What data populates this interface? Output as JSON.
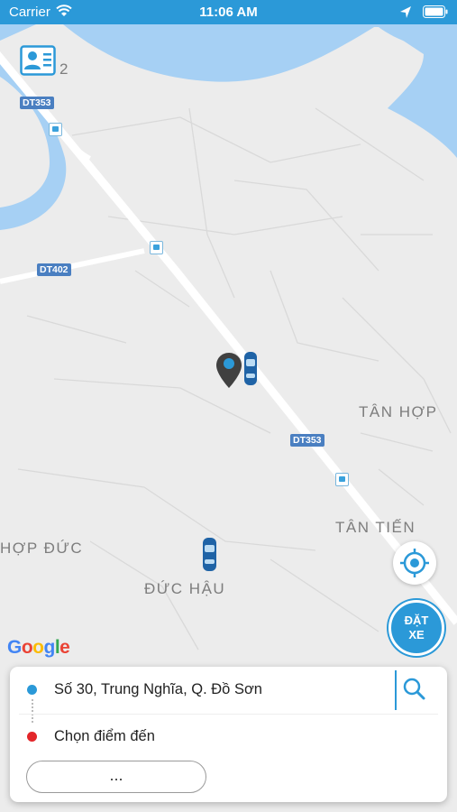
{
  "status_bar": {
    "carrier": "Carrier",
    "time": "11:06 AM"
  },
  "map": {
    "place_labels": {
      "tan_hop": "TÂN HỢP",
      "tan_tien": "TÂN TIẾN",
      "hop_duc": "HỢP ĐỨC",
      "duc_hau": "ĐỨC HẬU",
      "top_left": "2"
    },
    "road_labels": {
      "dt353_top": "DT353",
      "dt402": "DT402",
      "dt353_mid": "DT353"
    },
    "attribution": "Google"
  },
  "buttons": {
    "book_line1": "ĐẶT",
    "book_line2": "XE",
    "more": "..."
  },
  "trip": {
    "pickup": "Số 30, Trung Nghĩa, Q. Đồ Sơn",
    "destination": "Chọn điểm đến"
  },
  "colors": {
    "accent": "#2b99d8",
    "pickup_dot": "#2b99d8",
    "destination_dot": "#e3262a"
  }
}
